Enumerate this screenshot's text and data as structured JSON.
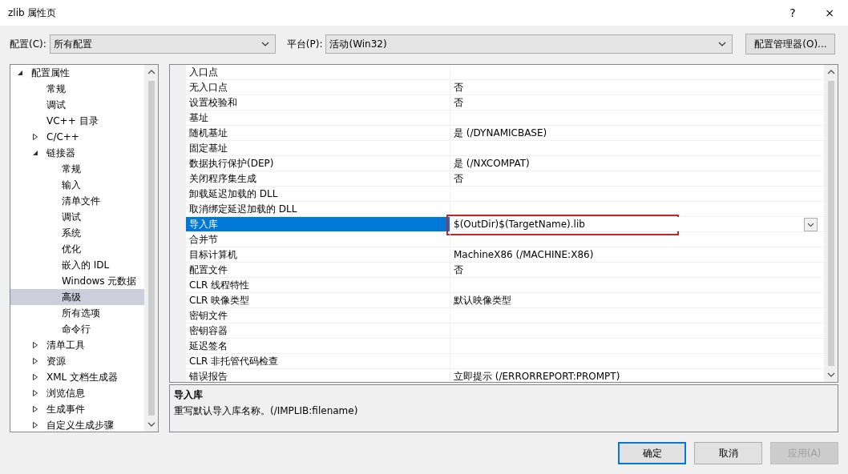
{
  "window": {
    "title": "zlib 属性页",
    "help": "?",
    "close": "×"
  },
  "toolbar": {
    "config_label": "配置(C):",
    "config_value": "所有配置",
    "platform_label": "平台(P):",
    "platform_value": "活动(Win32)",
    "manager_button": "配置管理器(O)..."
  },
  "sidebar": {
    "items": [
      {
        "label": "配置属性",
        "expanded": true,
        "selected": false,
        "children": [
          {
            "label": "常规",
            "selected": false
          },
          {
            "label": "调试",
            "selected": false
          },
          {
            "label": "VC++ 目录",
            "selected": false
          },
          {
            "label": "C/C++",
            "expanded": false,
            "selected": false
          },
          {
            "label": "链接器",
            "expanded": true,
            "selected": false,
            "children": [
              {
                "label": "常规",
                "selected": false
              },
              {
                "label": "输入",
                "selected": false
              },
              {
                "label": "清单文件",
                "selected": false
              },
              {
                "label": "调试",
                "selected": false
              },
              {
                "label": "系统",
                "selected": false
              },
              {
                "label": "优化",
                "selected": false
              },
              {
                "label": "嵌入的 IDL",
                "selected": false
              },
              {
                "label": "Windows 元数据",
                "selected": false
              },
              {
                "label": "高级",
                "selected": true
              },
              {
                "label": "所有选项",
                "selected": false
              },
              {
                "label": "命令行",
                "selected": false
              }
            ]
          },
          {
            "label": "清单工具",
            "expanded": false,
            "selected": false
          },
          {
            "label": "资源",
            "expanded": false,
            "selected": false
          },
          {
            "label": "XML 文档生成器",
            "expanded": false,
            "selected": false
          },
          {
            "label": "浏览信息",
            "expanded": false,
            "selected": false
          },
          {
            "label": "生成事件",
            "expanded": false,
            "selected": false
          },
          {
            "label": "自定义生成步骤",
            "expanded": false,
            "selected": false
          }
        ]
      }
    ]
  },
  "properties": {
    "rows": [
      {
        "name": "入口点",
        "value": "",
        "selected": false
      },
      {
        "name": "无入口点",
        "value": "否",
        "selected": false
      },
      {
        "name": "设置校验和",
        "value": "否",
        "selected": false
      },
      {
        "name": "基址",
        "value": "",
        "selected": false
      },
      {
        "name": "随机基址",
        "value": "是 (/DYNAMICBASE)",
        "selected": false
      },
      {
        "name": "固定基址",
        "value": "",
        "selected": false
      },
      {
        "name": "数据执行保护(DEP)",
        "value": "是 (/NXCOMPAT)",
        "selected": false
      },
      {
        "name": "关闭程序集生成",
        "value": "否",
        "selected": false
      },
      {
        "name": "卸载延迟加载的 DLL",
        "value": "",
        "selected": false
      },
      {
        "name": "取消绑定延迟加载的 DLL",
        "value": "",
        "selected": false
      },
      {
        "name": "导入库",
        "value": "$(OutDir)$(TargetName).lib",
        "selected": true,
        "highlighted": true
      },
      {
        "name": "合并节",
        "value": "",
        "selected": false
      },
      {
        "name": "目标计算机",
        "value": "MachineX86 (/MACHINE:X86)",
        "selected": false
      },
      {
        "name": "配置文件",
        "value": "否",
        "selected": false
      },
      {
        "name": "CLR 线程特性",
        "value": "",
        "selected": false
      },
      {
        "name": "CLR 映像类型",
        "value": "默认映像类型",
        "selected": false
      },
      {
        "name": "密钥文件",
        "value": "",
        "selected": false
      },
      {
        "name": "密钥容器",
        "value": "",
        "selected": false
      },
      {
        "name": "延迟签名",
        "value": "",
        "selected": false
      },
      {
        "name": "CLR 非托管代码检查",
        "value": "",
        "selected": false
      },
      {
        "name": "错误报告",
        "value": "立即提示 (/ERRORREPORT:PROMPT)",
        "selected": false
      }
    ]
  },
  "description": {
    "title": "导入库",
    "text": "重写默认导入库名称。(/IMPLIB:filename)"
  },
  "buttons": [
    {
      "label": "确定",
      "default": true,
      "disabled": false
    },
    {
      "label": "取消",
      "default": false,
      "disabled": false
    },
    {
      "label": "应用(A)",
      "default": false,
      "disabled": true
    }
  ]
}
